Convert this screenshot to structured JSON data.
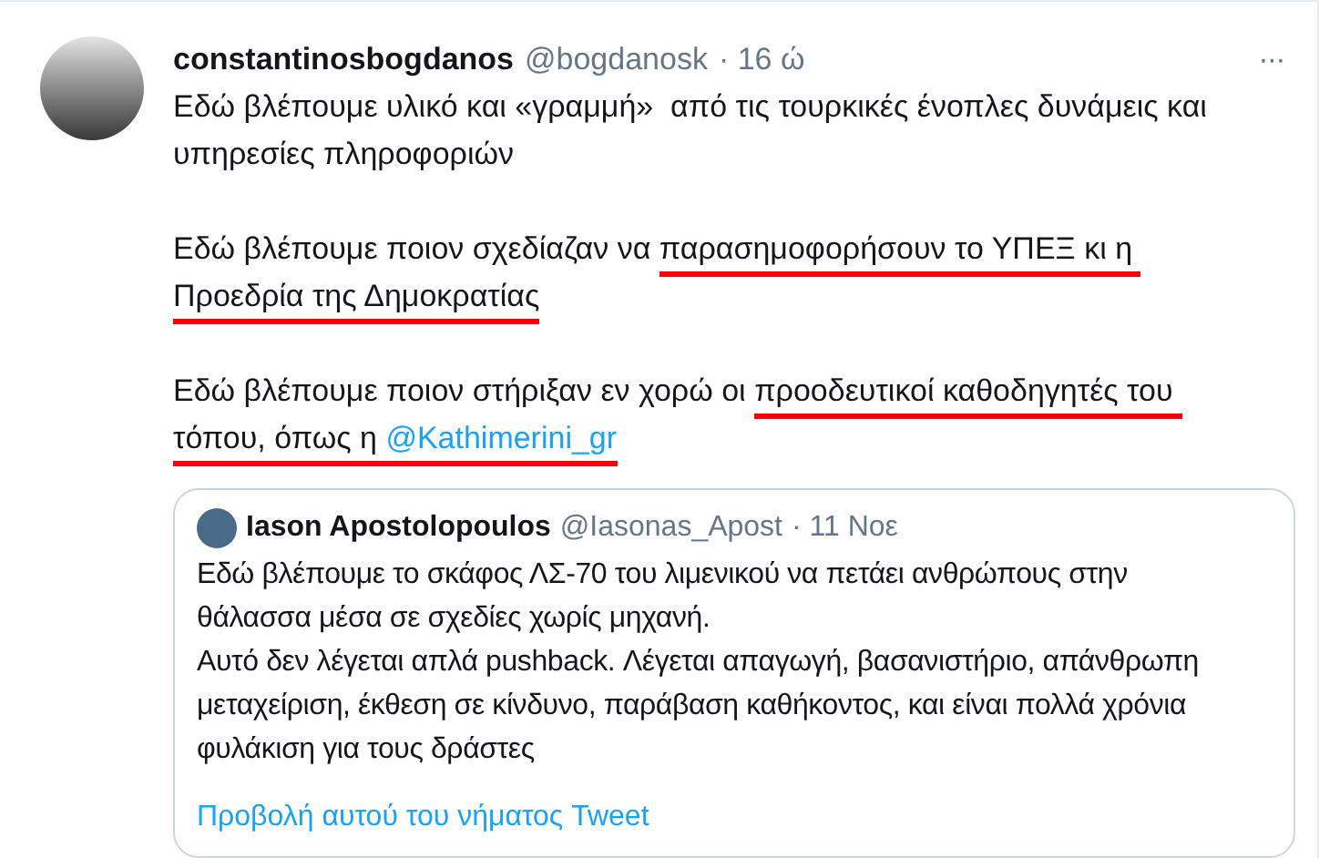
{
  "tweet": {
    "name": "constantinosbogdanos",
    "handle": "@bogdanosk",
    "time": "· 16 ώ",
    "more": "···",
    "paragraphs": [
      [
        {
          "kind": "text",
          "text": "Εδώ βλέπουμε υλικό και «γραμμή»  από τις τουρκικές ένοπλες δυνάμεις και υπηρεσίες πληροφοριών",
          "underlined": false
        }
      ],
      [
        {
          "kind": "text",
          "text": "Εδώ βλέπουμε ποιον σχεδίαζαν να ",
          "underlined": false
        },
        {
          "kind": "text",
          "text": "παρασημοφορήσουν το ΥΠΕΞ κι η Προεδρία της Δημοκρατίας",
          "underlined": true
        }
      ],
      [
        {
          "kind": "text",
          "text": "Εδώ βλέπουμε ποιον στήριξαν εν χορώ οι ",
          "underlined": false
        },
        {
          "kind": "text",
          "text": "προοδευτικοί καθοδηγητές του τόπου, όπως η ",
          "underlined": true
        },
        {
          "kind": "mention",
          "text": "@Kathimerini_gr",
          "underlined": true
        }
      ]
    ]
  },
  "quoted": {
    "name": "Iason Apostolopoulos",
    "handle": "@Iasonas_Apost",
    "time": "· 11 Νοε",
    "text": "Εδώ βλέπουμε το σκάφος ΛΣ-70 του λιμενικού να πετάει ανθρώπους στην θάλασσα μέσα σε σχεδίες χωρίς μηχανή.\nΑυτό δεν λέγεται απλά pushback. Λέγεται απαγωγή, βασανιστήριο, απάνθρωπη μεταχείριση, έκθεση σε κίνδυνο, παράβαση καθήκοντος, και είναι πολλά χρόνια φυλάκιση για τους δράστες",
    "link": "Προβολή αυτού του νήματος Tweet"
  }
}
